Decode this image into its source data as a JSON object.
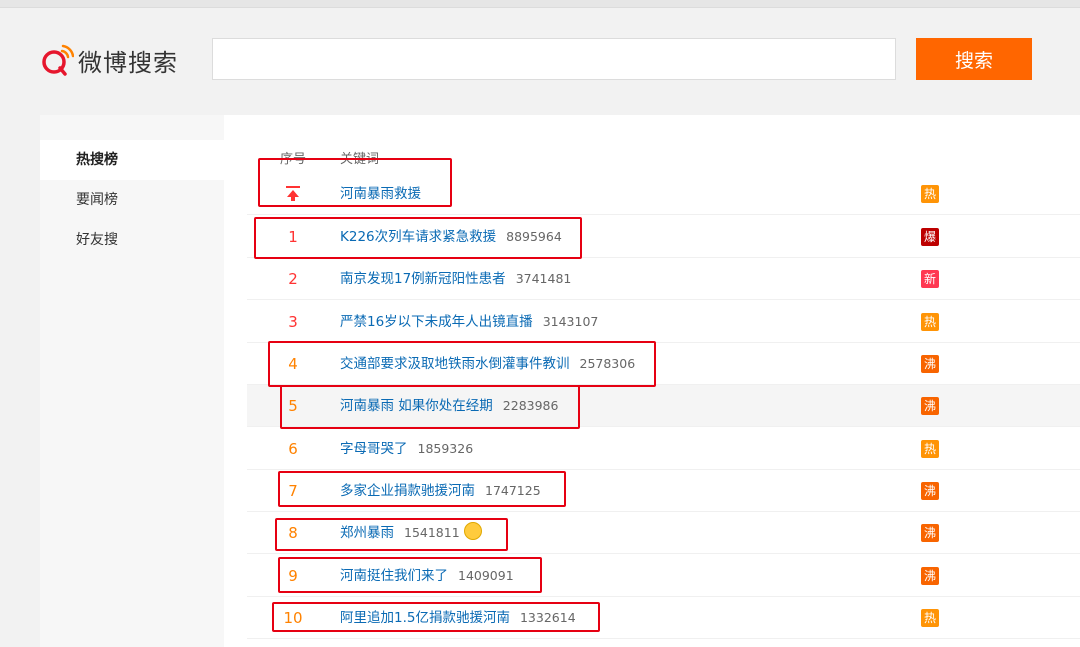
{
  "brand": {
    "name": "微博搜索"
  },
  "search": {
    "value": "",
    "placeholder": "",
    "button_label": "搜索"
  },
  "sidebar": {
    "items": [
      {
        "label": "热搜榜",
        "active": true
      },
      {
        "label": "要闻榜"
      },
      {
        "label": "好友搜"
      }
    ]
  },
  "table": {
    "headers": {
      "rank": "序号",
      "keyword": "关键词"
    },
    "pinned": {
      "title": "河南暴雨救援",
      "badge": "热"
    },
    "rows": [
      {
        "rank": "1",
        "title": "K226次列车请求紧急救援",
        "count": "8895964",
        "badge": "爆"
      },
      {
        "rank": "2",
        "title": "南京发现17例新冠阳性患者",
        "count": "3741481",
        "badge": "新"
      },
      {
        "rank": "3",
        "title": "严禁16岁以下未成年人出镜直播",
        "count": "3143107",
        "badge": "热"
      },
      {
        "rank": "4",
        "title": "交通部要求汲取地铁雨水倒灌事件教训",
        "count": "2578306",
        "badge": "沸"
      },
      {
        "rank": "5",
        "title": "河南暴雨 如果你处在经期",
        "count": "2283986",
        "badge": "沸"
      },
      {
        "rank": "6",
        "title": "字母哥哭了",
        "count": "1859326",
        "badge": "热"
      },
      {
        "rank": "7",
        "title": "多家企业捐款驰援河南",
        "count": "1747125",
        "badge": "沸"
      },
      {
        "rank": "8",
        "title": "郑州暴雨",
        "count": "1541811",
        "badge": "沸"
      },
      {
        "rank": "9",
        "title": "河南挺住我们来了",
        "count": "1409091",
        "badge": "沸"
      },
      {
        "rank": "10",
        "title": "阿里追加1.5亿捐款驰援河南",
        "count": "1332614",
        "badge": "热"
      }
    ]
  },
  "colors": {
    "accent": "#ff6600",
    "link": "#0a6ab4",
    "rank": "#ff8200",
    "rank_top": "#ff3333",
    "badge_hot": "#ff9406",
    "badge_boil": "#f86400",
    "badge_new": "#ff3852",
    "badge_boom": "#bd0000",
    "annotation": "#e60012"
  }
}
